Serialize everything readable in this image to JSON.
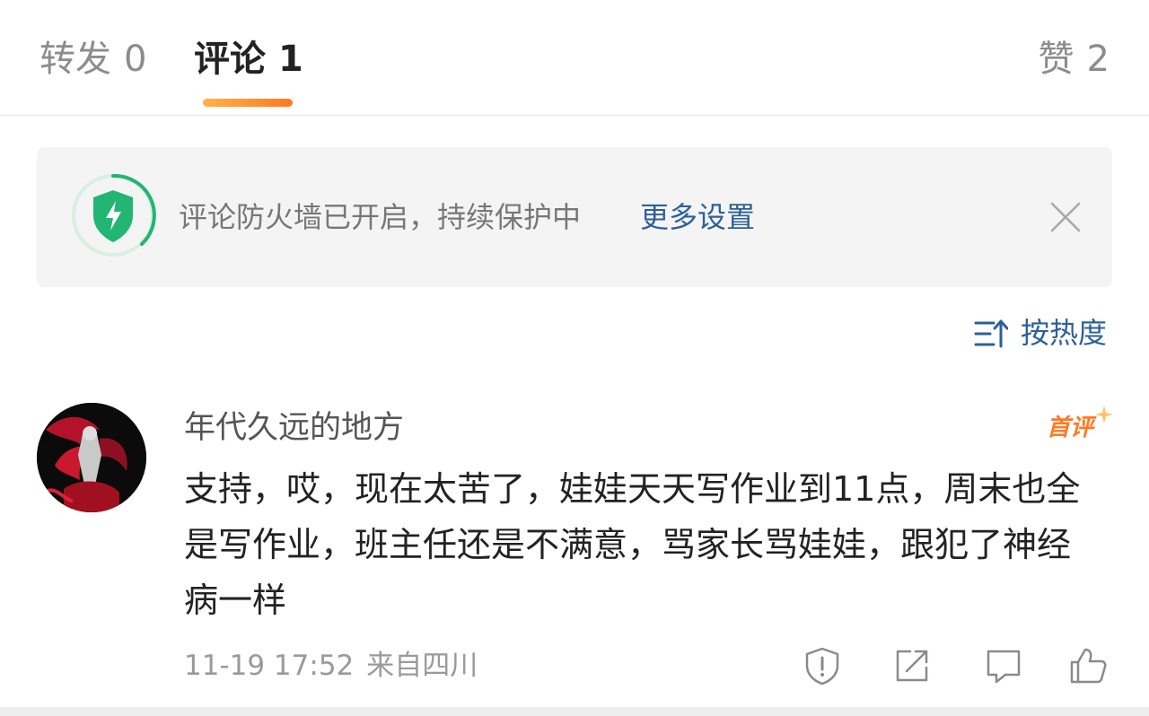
{
  "tabs": {
    "repost": {
      "label": "转发",
      "count": "0"
    },
    "comment": {
      "label": "评论",
      "count": "1"
    },
    "like": {
      "label": "赞",
      "count": "2"
    },
    "active_color": "#ff7a1f"
  },
  "firewall_notice": {
    "icon": "shield-lightning-icon",
    "text": "评论防火墙已开启，持续保护中",
    "link": "更多设置",
    "close_icon": "close-icon"
  },
  "sort": {
    "icon": "sort-icon",
    "label": "按热度"
  },
  "comment": {
    "username": "年代久远的地方",
    "badge": "首评",
    "text": "支持，哎，现在太苦了，娃娃天天写作业到11点，周末也全是写作业，班主任还是不满意，骂家长骂娃娃，跟犯了神经病一样",
    "timestamp": "11-19 17:52",
    "location": "来自四川",
    "actions": [
      "report-icon",
      "share-icon",
      "reply-icon",
      "like-icon"
    ]
  },
  "colors": {
    "link": "#2e5f99",
    "accent": "#ff7a1f",
    "shield": "#22b573"
  }
}
